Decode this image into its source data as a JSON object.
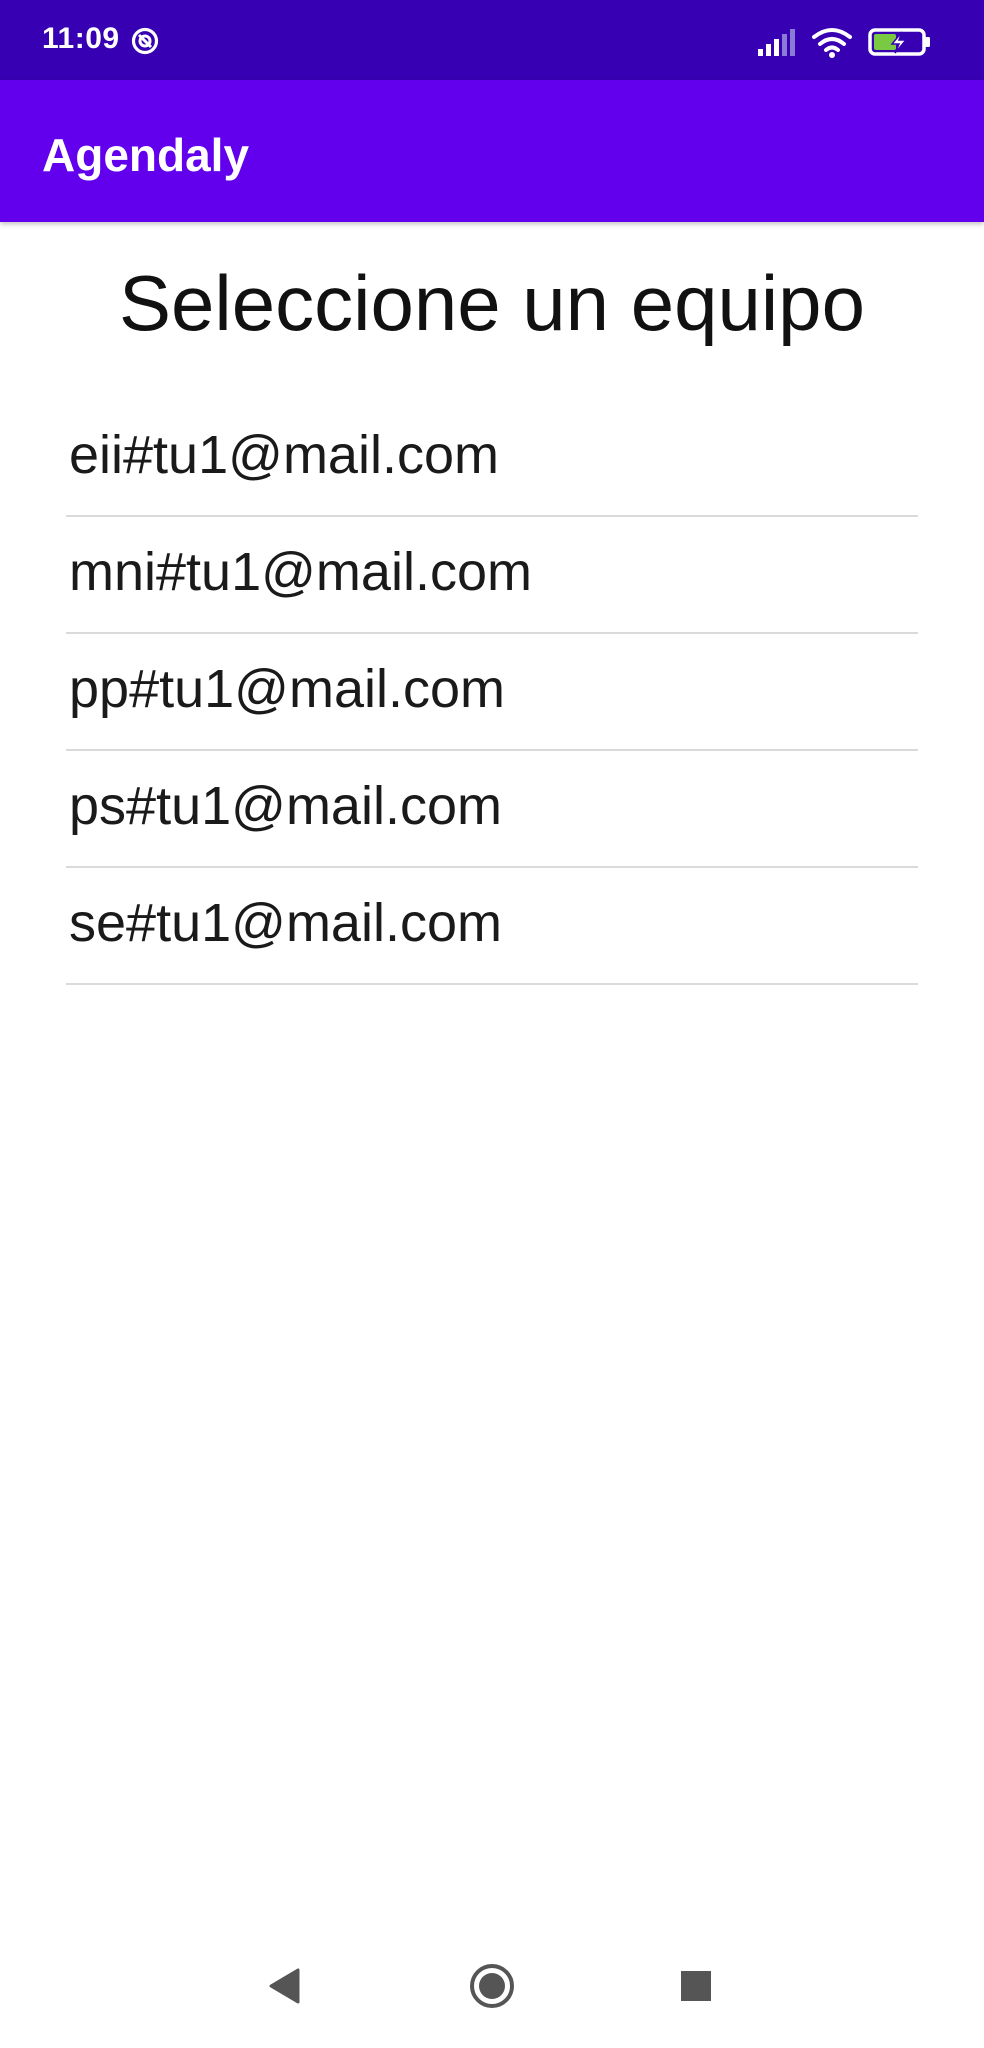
{
  "status_bar": {
    "time": "11:09",
    "icons": [
      "at-sign-icon",
      "signal-icon",
      "wifi-icon",
      "battery-charging-icon"
    ]
  },
  "app_bar": {
    "title": "Agendaly",
    "color": "#6200ee"
  },
  "page": {
    "heading": "Seleccione un equipo"
  },
  "teams": [
    {
      "label": "eii#tu1@mail.com"
    },
    {
      "label": "mni#tu1@mail.com"
    },
    {
      "label": "pp#tu1@mail.com"
    },
    {
      "label": "ps#tu1@mail.com"
    },
    {
      "label": "se#tu1@mail.com"
    }
  ],
  "nav_bar": {
    "buttons": [
      "back-icon",
      "home-icon",
      "recents-icon"
    ]
  },
  "colors": {
    "status_bar": "#3700b3",
    "app_bar": "#6200ee",
    "divider": "#dadada",
    "battery_fill": "#7ac943"
  }
}
